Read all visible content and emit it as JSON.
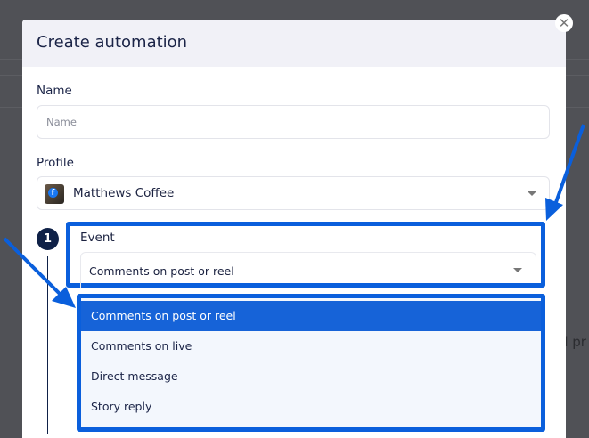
{
  "background": {
    "partial_text": "d pr"
  },
  "modal": {
    "title": "Create automation",
    "close_icon": "x-icon",
    "name": {
      "label": "Name",
      "value": "",
      "placeholder": "Name"
    },
    "profile": {
      "label": "Profile",
      "selected": "Matthews Coffee",
      "avatar_badge": "f"
    },
    "step": {
      "number": "1",
      "event": {
        "label": "Event",
        "selected": "Comments on post or reel",
        "options": [
          "Comments on post or reel",
          "Comments on live",
          "Direct message",
          "Story reply"
        ]
      }
    }
  },
  "colors": {
    "highlight": "#0a5fdc",
    "selected_option": "#1663d8",
    "header_bg": "#f1f1f7",
    "step_badge": "#0f2147"
  }
}
